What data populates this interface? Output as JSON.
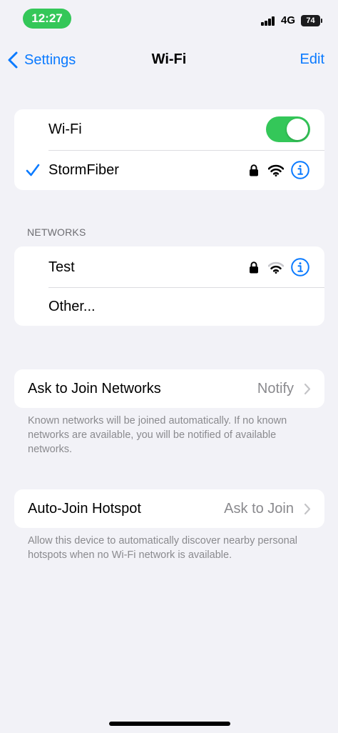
{
  "status_bar": {
    "time": "12:27",
    "network": "4G",
    "battery": "74",
    "time_pill_color": "#34c759"
  },
  "nav": {
    "back_label": "Settings",
    "title": "Wi-Fi",
    "edit_label": "Edit",
    "accent_color": "#0a7aff"
  },
  "wifi_group": {
    "toggle_label": "Wi-Fi",
    "toggle_on": true,
    "connected_network": "StormFiber"
  },
  "networks": {
    "header": "NETWORKS",
    "items": [
      {
        "name": "Test",
        "secured": true
      },
      {
        "name": "Other..."
      }
    ]
  },
  "ask_to_join": {
    "label": "Ask to Join Networks",
    "value": "Notify",
    "footer": "Known networks will be joined automatically. If no known networks are available, you will be notified of available networks."
  },
  "auto_join_hotspot": {
    "label": "Auto-Join Hotspot",
    "value": "Ask to Join",
    "footer": "Allow this device to automatically discover nearby personal hotspots when no Wi-Fi network is available."
  }
}
